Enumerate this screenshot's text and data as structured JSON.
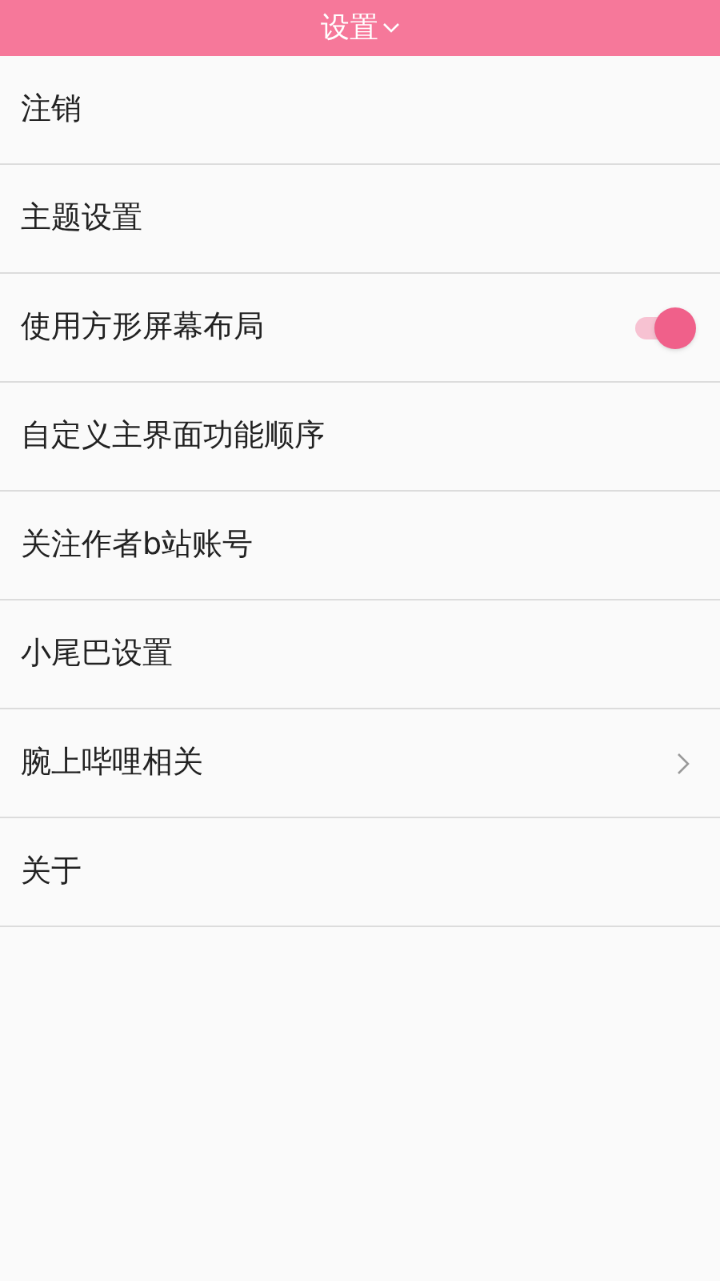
{
  "header": {
    "title": "设置"
  },
  "items": [
    {
      "label": "注销",
      "kind": "plain"
    },
    {
      "label": "主题设置",
      "kind": "plain"
    },
    {
      "label": "使用方形屏幕布局",
      "kind": "toggle",
      "on": true
    },
    {
      "label": "自定义主界面功能顺序",
      "kind": "plain"
    },
    {
      "label": "关注作者b站账号",
      "kind": "plain"
    },
    {
      "label": "小尾巴设置",
      "kind": "plain"
    },
    {
      "label": "腕上哔哩相关",
      "kind": "link"
    },
    {
      "label": "关于",
      "kind": "plain"
    }
  ]
}
